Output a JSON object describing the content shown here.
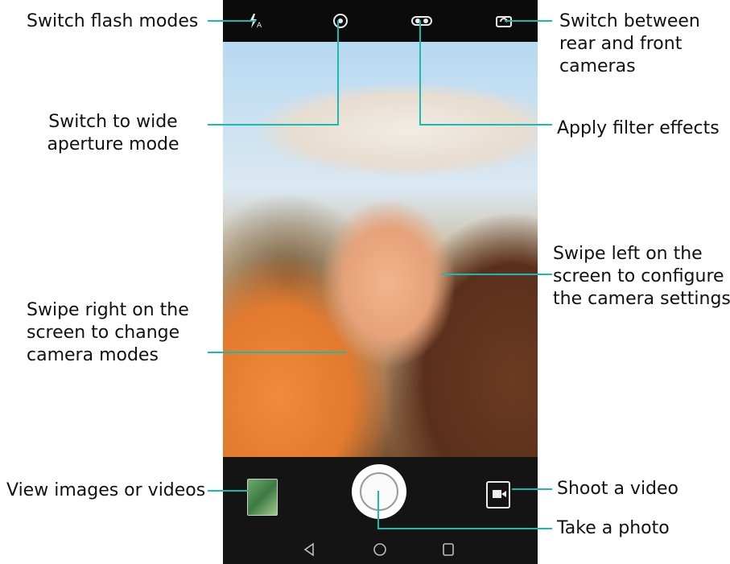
{
  "annotations": {
    "flash": "Switch flash modes",
    "aperture_line1": "Switch to wide",
    "aperture_line2": "aperture mode",
    "switch_camera_line1": "Switch between",
    "switch_camera_line2": "rear and front",
    "switch_camera_line3": "cameras",
    "filter": "Apply filter effects",
    "swipe_right_line1": "Swipe right on the",
    "swipe_right_line2": "screen to change",
    "swipe_right_line3": "camera modes",
    "swipe_left_line1": "Swipe left on the",
    "swipe_left_line2": "screen to configure",
    "swipe_left_line3": "the camera settings",
    "gallery": "View images or videos",
    "video": "Shoot a video",
    "photo": "Take a photo"
  },
  "icons": {
    "flash": "flash-auto-icon",
    "aperture": "aperture-icon",
    "filter": "filter-icon",
    "switch_camera": "switch-camera-icon",
    "gallery": "gallery-thumbnail",
    "shutter": "shutter-icon",
    "video": "video-camera-icon",
    "nav_back": "back-triangle-icon",
    "nav_home": "home-circle-icon",
    "nav_recent": "recent-square-icon"
  },
  "colors": {
    "callout_line": "#1bb9b0",
    "bar_background": "#0b0b0b",
    "icon": "#ededed"
  }
}
